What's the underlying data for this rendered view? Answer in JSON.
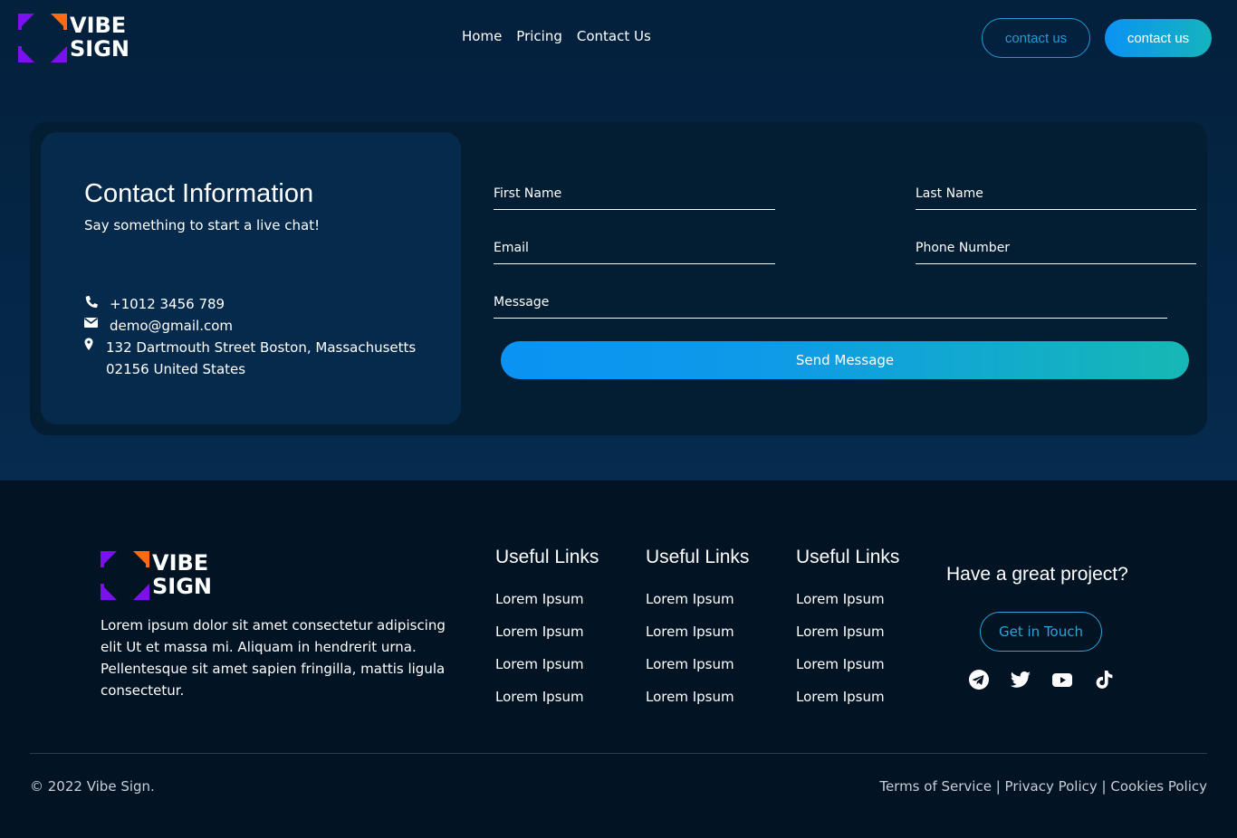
{
  "brand": {
    "logo_line1": "VIBE",
    "logo_line2": "SIGN",
    "colors": {
      "purple": "#7a12f0",
      "orange": "#ff6a13",
      "accent": "#1f9bd4"
    }
  },
  "nav": {
    "items": [
      {
        "label": "Home"
      },
      {
        "label": "Pricing"
      },
      {
        "label": "Contact Us"
      }
    ]
  },
  "header": {
    "outline_button": "contact us",
    "fill_button": "contact us"
  },
  "contact": {
    "title": "Contact Information",
    "subtitle": "Say something to start a live chat!",
    "phone": "+1012 3456 789",
    "email": "demo@gmail.com",
    "address_line1": "132 Dartmouth Street Boston, Massachusetts",
    "address_line2": "02156 United States",
    "icons": [
      "phone-icon",
      "envelope-icon",
      "map-pin-icon"
    ]
  },
  "form": {
    "first_name": "First Name",
    "last_name": "Last Name",
    "email": "Email",
    "phone": "Phone Number",
    "message": "Message",
    "submit": "Send Message"
  },
  "footer": {
    "description": "Lorem ipsum dolor sit amet consectetur adipiscing elit Ut et massa mi. Aliquam in hendrerit urna. Pellentesque sit amet sapien fringilla, mattis ligula consectetur.",
    "columns": [
      {
        "title": "Useful Links",
        "links": [
          "Lorem Ipsum",
          "Lorem Ipsum",
          "Lorem Ipsum",
          "Lorem Ipsum"
        ]
      },
      {
        "title": "Useful Links",
        "links": [
          "Lorem Ipsum",
          "Lorem Ipsum",
          "Lorem Ipsum",
          "Lorem Ipsum"
        ]
      },
      {
        "title": "Useful Links",
        "links": [
          "Lorem Ipsum",
          "Lorem Ipsum",
          "Lorem Ipsum",
          "Lorem Ipsum"
        ]
      }
    ],
    "project_heading": "Have a great project?",
    "get_in_touch": "Get in Touch",
    "socials": [
      "telegram-icon",
      "twitter-icon",
      "youtube-icon",
      "tiktok-icon"
    ],
    "copyright": "© 2022 Vibe Sign.",
    "legal": {
      "terms": "Terms of Service",
      "privacy": "Privacy Policy",
      "cookies": "Cookies Policy",
      "separator": " | "
    }
  }
}
